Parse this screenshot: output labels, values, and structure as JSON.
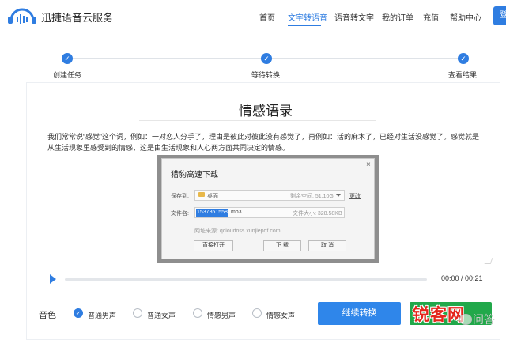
{
  "header": {
    "brand": "迅捷语音云服务",
    "nav": [
      "首页",
      "文字转语音",
      "语音转文字",
      "我的订单",
      "充值",
      "帮助中心"
    ],
    "active_nav": "文字转语音",
    "login_label": "登",
    "accent_color": "#2f7de1"
  },
  "steps": [
    {
      "label": "创建任务",
      "done": true
    },
    {
      "label": "等待转换",
      "done": true
    },
    {
      "label": "查看结果",
      "done": true
    }
  ],
  "card": {
    "title": "情感语录",
    "paragraph": "我们常常说“感觉”这个词，例如：一对恋人分手了，理由是彼此对彼此没有感觉了，再例如：活的麻木了，已经对生活没感觉了。感觉就是从生活现象里感受到的情感，这是由生活现象和人心两方面共同决定的情感。"
  },
  "player": {
    "time": "00:00 / 00:21",
    "progress": 0
  },
  "voice": {
    "label": "音色",
    "options": [
      "普通男声",
      "普通女声",
      "情感男声",
      "情感女声"
    ],
    "selected": "普通男声"
  },
  "actions": {
    "continue_label": "继续转换"
  },
  "dialog": {
    "title": "猎豹高速下载",
    "close": "×",
    "save_label": "保存到:",
    "save_location": "桌面",
    "free_space": "剩余空间: 51.10G",
    "change_label": "更改",
    "filename_label": "文件名:",
    "filename_selected": "1537861558",
    "filename_ext": ".mp3",
    "file_size": "文件大小: 328.58KB",
    "source": "网址来源: qcloudoss.xunjiepdf.com",
    "open_button": "直接打开",
    "download_button": "下 载",
    "cancel_button": "取 消"
  },
  "watermark": {
    "main": "锐客网",
    "sub": "问答"
  }
}
